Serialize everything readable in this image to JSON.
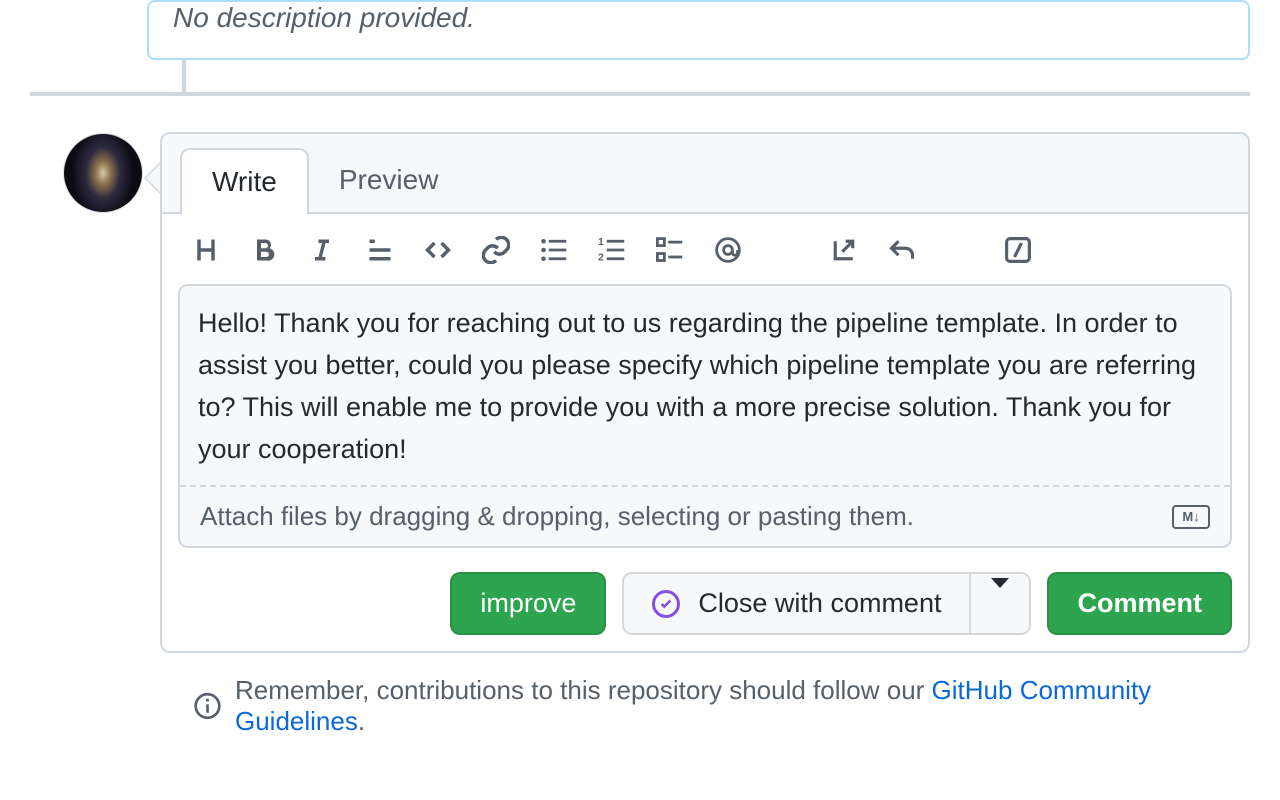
{
  "top": {
    "no_description": "No description provided."
  },
  "tabs": {
    "write": "Write",
    "preview": "Preview"
  },
  "editor": {
    "value": "Hello! Thank you for reaching out to us regarding the pipeline template. In order to assist you better, could you please specify which pipeline template you are referring to? This will enable me to provide you with a more precise solution. Thank you for your cooperation!",
    "attach_hint": "Attach files by dragging & dropping, selecting or pasting them.",
    "markdown_badge": "M↓"
  },
  "actions": {
    "improve": "improve",
    "close": "Close with comment",
    "comment": "Comment"
  },
  "footer": {
    "prefix": "Remember, contributions to this repository should follow our ",
    "link": "GitHub Community Guidelines",
    "suffix": "."
  }
}
